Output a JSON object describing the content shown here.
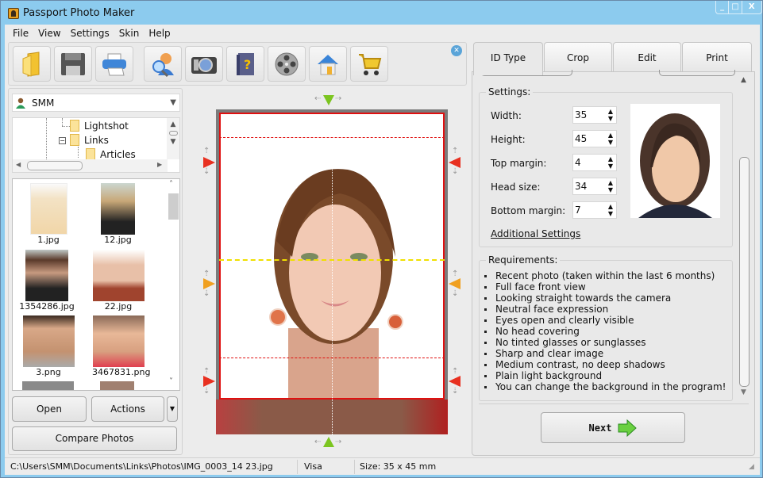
{
  "window": {
    "title": "Passport Photo Maker",
    "controls": {
      "minimize": "_",
      "maximize": "□",
      "close": "X"
    }
  },
  "menu": [
    "File",
    "View",
    "Settings",
    "Skin",
    "Help"
  ],
  "toolbar": {
    "buttons": [
      {
        "name": "open-folder",
        "icon": "folder-icon"
      },
      {
        "name": "save",
        "icon": "floppy-disk-icon"
      },
      {
        "name": "print",
        "icon": "printer-icon"
      },
      {
        "name": "find-face",
        "icon": "user-search-icon"
      },
      {
        "name": "camera",
        "icon": "camera-icon"
      },
      {
        "name": "help",
        "icon": "help-book-icon"
      },
      {
        "name": "video-tutorial",
        "icon": "film-reel-icon"
      },
      {
        "name": "home",
        "icon": "house-icon"
      },
      {
        "name": "buy",
        "icon": "shopping-cart-icon"
      }
    ],
    "close_glyph": "✕"
  },
  "left_panel": {
    "user_combo": {
      "value": "SMM",
      "arrow": "▼"
    },
    "tree": [
      {
        "label": "Lightshot",
        "level": 1
      },
      {
        "label": "Links",
        "level": 1,
        "expanded": true,
        "toggle": "−"
      },
      {
        "label": "Articles",
        "level": 2
      }
    ],
    "thumbnails": [
      {
        "file": "1.jpg",
        "color": "#f3e2c4"
      },
      {
        "file": "12.jpg",
        "color": "#c8a878"
      },
      {
        "file": "1354286.jpg",
        "color": "#5a3a2a"
      },
      {
        "file": "22.jpg",
        "color": "#a0442e"
      },
      {
        "file": "3.png",
        "color": "#c49270"
      },
      {
        "file": "3467831.png",
        "color": "#b2806a"
      }
    ],
    "buttons": {
      "open": "Open",
      "actions": "Actions",
      "actions_dropdown": "▼",
      "compare": "Compare Photos"
    }
  },
  "tabs": [
    {
      "label": "ID Type",
      "active": true
    },
    {
      "label": "Crop",
      "active": false
    },
    {
      "label": "Edit",
      "active": false
    },
    {
      "label": "Print",
      "active": false
    }
  ],
  "settings": {
    "label": "Settings:",
    "fields": [
      {
        "label": "Width:",
        "value": "35"
      },
      {
        "label": "Height:",
        "value": "45"
      },
      {
        "label": "Top margin:",
        "value": "4"
      },
      {
        "label": "Head size:",
        "value": "34"
      },
      {
        "label": "Bottom margin:",
        "value": "7"
      }
    ],
    "additional_link": "Additional Settings"
  },
  "requirements": {
    "label": "Requirements:",
    "items": [
      "Recent photo (taken within the last 6 months)",
      "Full face front view",
      "Looking straight towards the camera",
      "Neutral face expression",
      "Eyes open and clearly visible",
      "No head covering",
      "No tinted glasses or sunglasses",
      "Sharp and clear image",
      "Medium contrast, no deep shadows",
      "Plain light background",
      "You can change the background in the program!"
    ]
  },
  "next_button": {
    "label": "Next"
  },
  "status": {
    "path": "C:\\Users\\SMM\\Documents\\Links\\Photos\\IMG_0003_14 23.jpg",
    "id_type": "Visa",
    "size": "Size: 35 x 45 mm"
  },
  "colors": {
    "title_bar": "#8ccbee",
    "crop_frame": "#e01010",
    "eye_line": "#f0e000",
    "guide_handle_green": "#7cc520",
    "guide_handle_red": "#e83020",
    "guide_handle_orange": "#f0a020"
  }
}
